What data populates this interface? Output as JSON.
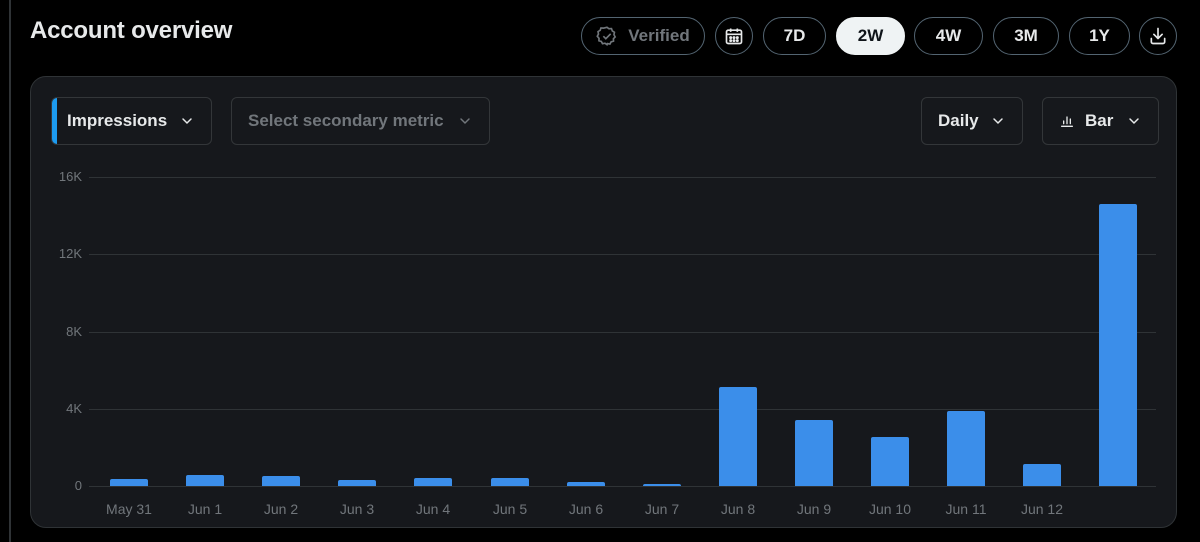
{
  "header": {
    "title": "Account overview",
    "verified_label": "Verified",
    "ranges": [
      "7D",
      "2W",
      "4W",
      "3M",
      "1Y"
    ],
    "active_range": "2W"
  },
  "controls": {
    "primary_metric": "Impressions",
    "secondary_placeholder": "Select secondary metric",
    "interval": "Daily",
    "chart_type": "Bar"
  },
  "colors": {
    "accent": "#1d9bf0",
    "bar": "#3b8eea",
    "background": "#000000",
    "card": "#16181c"
  },
  "icons": [
    "verified-badge-icon",
    "calendar-icon",
    "download-icon",
    "chevron-down-icon",
    "bar-chart-icon"
  ],
  "chart_data": {
    "type": "bar",
    "categories": [
      "May 31",
      "Jun 1",
      "Jun 2",
      "Jun 3",
      "Jun 4",
      "Jun 5",
      "Jun 6",
      "Jun 7",
      "Jun 8",
      "Jun 9",
      "Jun 10",
      "Jun 11",
      "Jun 12",
      ""
    ],
    "series": [
      {
        "values": [
          350,
          550,
          530,
          320,
          430,
          420,
          200,
          80,
          5150,
          3400,
          2520,
          3870,
          1130,
          14620
        ]
      }
    ],
    "ylim": [
      0,
      16000
    ],
    "yticks": [
      0,
      4000,
      8000,
      12000,
      16000
    ],
    "ytick_labels": [
      "0",
      "4K",
      "8K",
      "12K",
      "16K"
    ],
    "grid": true,
    "legend": "none"
  }
}
